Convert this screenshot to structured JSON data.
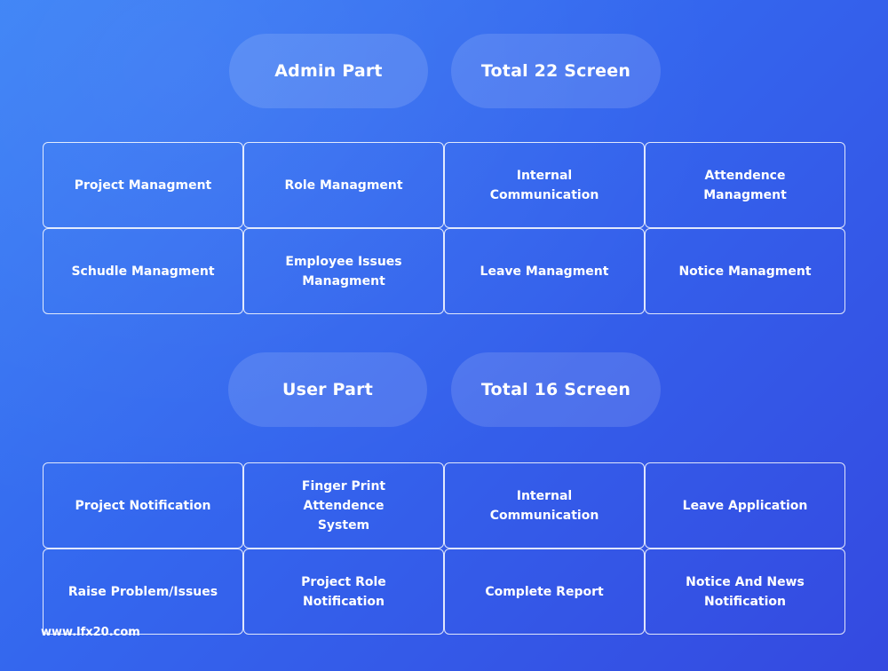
{
  "admin": {
    "title": "Admin Part",
    "screens": "Total 22 Screen",
    "items": [
      "Project Managment",
      "Role Managment",
      "Internal Communication",
      "Attendence Managment",
      "Schudle Managment",
      "Employee Issues Managment",
      "Leave Managment",
      "Notice Managment"
    ]
  },
  "user": {
    "title": "User Part",
    "screens": "Total 16 Screen",
    "items": [
      "Project Notification",
      "Finger Print Attendence System",
      "Internal Communication",
      "Leave Application",
      "Raise Problem/Issues",
      "Project Role Notification",
      "Complete Report",
      "Notice And News Notification"
    ]
  },
  "watermark": "www.lfx20.com"
}
